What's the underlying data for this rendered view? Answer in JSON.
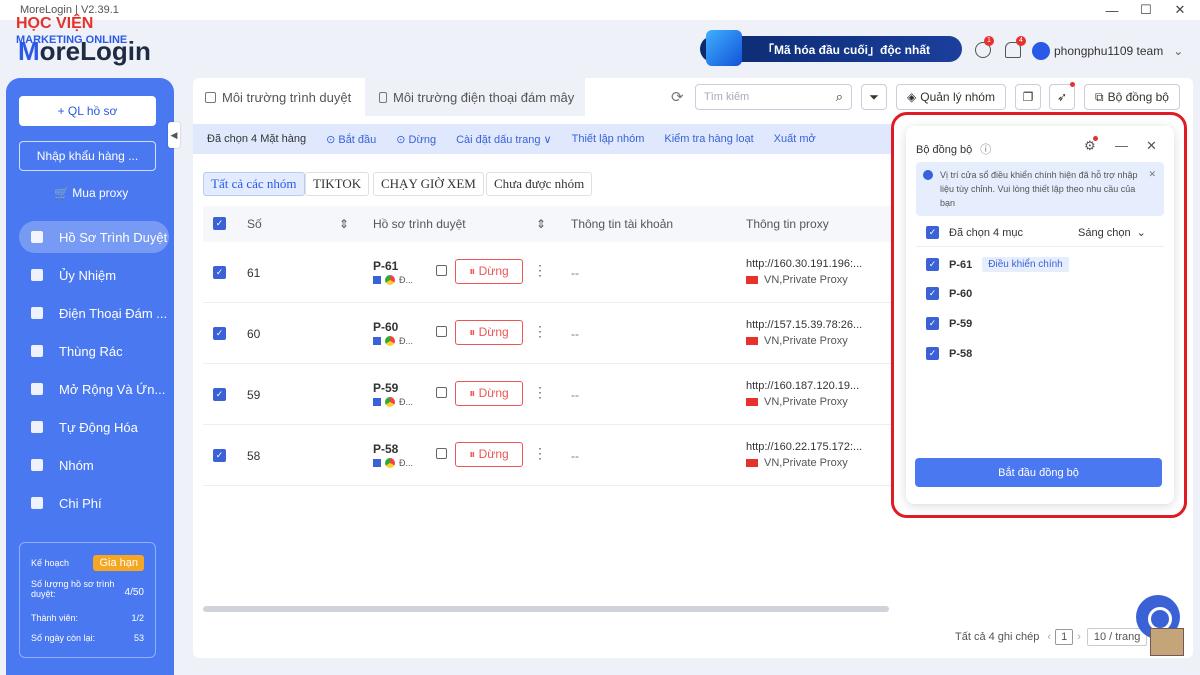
{
  "titlebar": {
    "title": "MoreLogin | V2.39.1"
  },
  "watermark": {
    "line1": "HỌC VIỆN",
    "line2": "MARKETING ONLINE"
  },
  "header": {
    "logo_pre": "M",
    "logo_rest": "oreLogin",
    "banner": "「Mã hóa đầu cuối」độc nhất",
    "badge1": "1",
    "badge2": "4",
    "user": "phongphu1109 team"
  },
  "sidebar": {
    "new_profile": "+ QL hồ sơ",
    "import": "Nhập khẩu hàng ...",
    "buy_proxy": "🛒 Mua proxy",
    "items": [
      "Hồ Sơ Trình Duyệt",
      "Ủy Nhiệm",
      "Điện Thoại Đám ...",
      "Thùng Rác",
      "Mở Rộng Và Ứn...",
      "Tự Động Hóa",
      "Nhóm",
      "Chi Phí"
    ],
    "plan": {
      "label": "Kế hoạch",
      "renew": "Gia hạn",
      "r1_label": "Số lượng hồ sơ trình duyệt:",
      "r1_val": "4/50",
      "r2_label": "Thành viên:",
      "r2_val": "1/2",
      "r3_label": "Số ngày còn lại:",
      "r3_val": "53"
    }
  },
  "tabs": [
    "Môi trường trình duyệt",
    "Môi trường điện thoại đám mây"
  ],
  "toolbar": {
    "search_placeholder": "Tìm kiếm",
    "group_mgmt": "Quản lý nhóm",
    "sync": "Bộ đồng bộ"
  },
  "actions": {
    "selected": "Đã chọn 4 Mặt hàng",
    "start": "⊙ Bắt đầu",
    "stop": "⊙ Dừng",
    "homepage": "Cài đặt dấu trang ∨",
    "group": "Thiết lập nhóm",
    "check": "Kiểm tra hàng loạt",
    "export": "Xuất mở"
  },
  "filters": [
    "Tất cả các nhóm",
    "TIKTOK",
    "CHẠY GIỜ XEM",
    "Chưa được nhóm"
  ],
  "columns": {
    "num": "Số",
    "profile": "Hồ sơ trình duyệt",
    "account": "Thông tin tài khoản",
    "proxy": "Thông tin proxy"
  },
  "rows": [
    {
      "num": "61",
      "name": "P-61",
      "os": "Đ...",
      "stop": "⏸ Dừng",
      "account": "--",
      "proxy": "http://160.30.191.196:...",
      "proxy_type": "VN,Private Proxy"
    },
    {
      "num": "60",
      "name": "P-60",
      "os": "Đ...",
      "stop": "⏸ Dừng",
      "account": "--",
      "proxy": "http://157.15.39.78:26...",
      "proxy_type": "VN,Private Proxy"
    },
    {
      "num": "59",
      "name": "P-59",
      "os": "Đ...",
      "stop": "⏸ Dừng",
      "account": "--",
      "proxy": "http://160.187.120.19...",
      "proxy_type": "VN,Private Proxy"
    },
    {
      "num": "58",
      "name": "P-58",
      "os": "Đ...",
      "stop": "⏸ Dừng",
      "account": "--",
      "proxy": "http://160.22.175.172:...",
      "proxy_type": "VN,Private Proxy"
    }
  ],
  "pager": {
    "total": "Tất cả 4 ghi chép",
    "page": "1",
    "per": "10 / trang"
  },
  "sync_panel": {
    "title": "Bộ đồng bộ",
    "info": "Vị trí cửa sổ điều khiển chính hiện đã hỗ trợ nhập liệu tùy chỉnh. Vui lòng thiết lập theo nhu cầu của bạn",
    "selected": "Đã chọn 4 mục",
    "sort": "Sáng chọn",
    "items": [
      "P-61",
      "P-60",
      "P-59",
      "P-58"
    ],
    "main_tag": "Điều khiển chính",
    "start": "Bắt đầu đồng bộ"
  }
}
